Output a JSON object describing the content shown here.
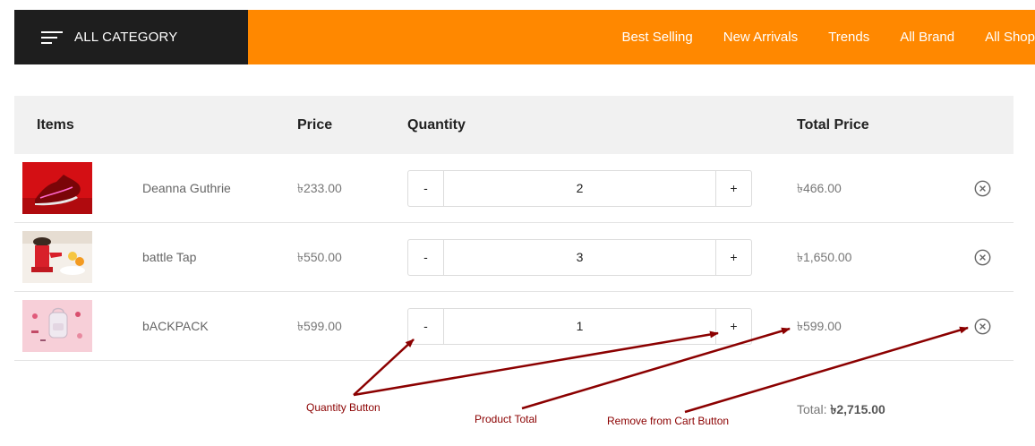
{
  "nav": {
    "category_label": "ALL CATEGORY",
    "links": [
      "Best Selling",
      "New Arrivals",
      "Trends",
      "All Brand",
      "All Shop"
    ]
  },
  "table": {
    "headers": {
      "items": "Items",
      "price": "Price",
      "quantity": "Quantity",
      "total": "Total Price"
    },
    "rows": [
      {
        "name": "Deanna Guthrie",
        "price": "৳233.00",
        "quantity": "2",
        "total": "৳466.00"
      },
      {
        "name": "battle Tap",
        "price": "৳550.00",
        "quantity": "3",
        "total": "৳1,650.00"
      },
      {
        "name": "bACKPACK",
        "price": "৳599.00",
        "quantity": "1",
        "total": "৳599.00"
      }
    ],
    "qty_minus": "-",
    "qty_plus": "+"
  },
  "summary": {
    "label": "Total:",
    "value": "৳2,715.00"
  },
  "annotations": {
    "quantity_button": "Quantity Button",
    "product_total": "Product Total",
    "remove_button": "Remove from Cart Button"
  },
  "colors": {
    "nav_bg": "#ff8800",
    "category_bg": "#1e1e1e",
    "annotation": "#8b0000"
  },
  "icons": {
    "menu": "hamburger-icon",
    "remove": "close-circle-icon"
  }
}
